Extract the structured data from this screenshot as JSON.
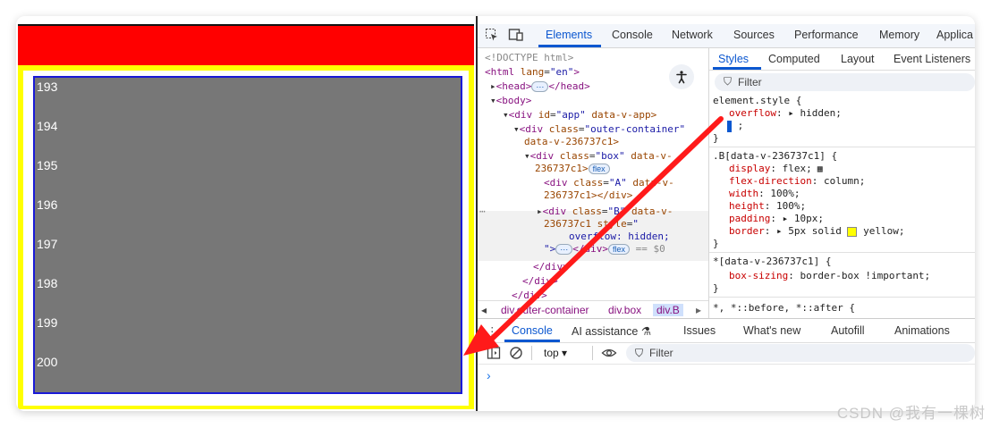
{
  "preview": {
    "numbers": [
      "193",
      "194",
      "195",
      "196",
      "197",
      "198",
      "199",
      "200"
    ],
    "colors": {
      "top_bar": "#ff0000",
      "outer_border": "#ffff00",
      "inner": "#777777",
      "inner_border": "#1a1ad6"
    }
  },
  "devtools": {
    "toolbar": {
      "inspect_icon": "inspect-element-icon",
      "device_icon": "device-toolbar-icon",
      "tabs": [
        "Elements",
        "Console",
        "Network",
        "Sources",
        "Performance",
        "Memory",
        "Applica"
      ]
    },
    "elements": {
      "doctype": "<!DOCTYPE html>",
      "html_tag": "<html",
      "html_attr": "lang",
      "html_val": "\"en\"",
      "head": "<head>",
      "head_dots": "⋯",
      "head_close": "</head>",
      "body": "<body>",
      "app_tag": "<div",
      "app_attr": "id",
      "app_val": "\"app\"",
      "app_attr2": "data-v-app>",
      "outer_tag": "<div",
      "outer_attr": "class",
      "outer_val": "\"outer-container\"",
      "outer_attr2": "data-v-236737c1>",
      "box_tag": "<div",
      "box_attr": "class",
      "box_val": "\"box\"",
      "box_attr2": "data-v-",
      "box_attr3": "236737c1>",
      "box_badge": "flex",
      "a_tag": "<div",
      "a_attr": "class",
      "a_val": "\"A\"",
      "a_attr2": "data-v-",
      "a_attr3": "236737c1></div>",
      "b_tag": "<div",
      "b_attr": "class",
      "b_val": "\"B\"",
      "b_attr2": "data-v-",
      "b_attr3": "236737c1",
      "b_attr4": "style",
      "b_val2": "\"",
      "b_style": "overflow: hidden;",
      "b_close1": "\">",
      "b_dots": "⋯",
      "b_close2": "</div>",
      "b_badge": "flex",
      "b_eq": "== $0",
      "close_div1": "</div>",
      "close_div2": "</div>",
      "close_div3": "</div>",
      "row_dots": "⋯",
      "a11y_icon": "accessibility-icon"
    },
    "breadcrumb": [
      "div.outer-container",
      "div.box",
      "div.B"
    ],
    "styles": {
      "tabs": [
        "Styles",
        "Computed",
        "Layout",
        "Event Listeners"
      ],
      "filter": "Filter",
      "element_style": "element.style {",
      "overflow_prop": "overflow",
      "overflow_val": "hidden;",
      "semicolon": ";",
      "close": "}",
      "rule_b": ".B[data-v-236737c1] {",
      "display_prop": "display",
      "display_val": "flex;",
      "flex_dir_prop": "flex-direction",
      "flex_dir_val": "column;",
      "width_prop": "width",
      "width_val": "100%;",
      "height_prop": "height",
      "height_val": "100%;",
      "padding_prop": "padding",
      "padding_val": "10px;",
      "border_prop": "border",
      "border_val1": "5px solid",
      "border_val2": "yellow;",
      "rule_star": "*[data-v-236737c1] {",
      "boxsizing_prop": "box-sizing",
      "boxsizing_val": "border-box !important;",
      "rule_all": "*, *::before, *::after {"
    },
    "drawer": {
      "tabs": [
        "Console",
        "AI assistance ⚗",
        "Issues",
        "What's new",
        "Autofill",
        "Animations"
      ],
      "context": "top ▾",
      "filter": "Filter",
      "prompt": "›"
    }
  },
  "watermark": "CSDN @我有一棵树"
}
